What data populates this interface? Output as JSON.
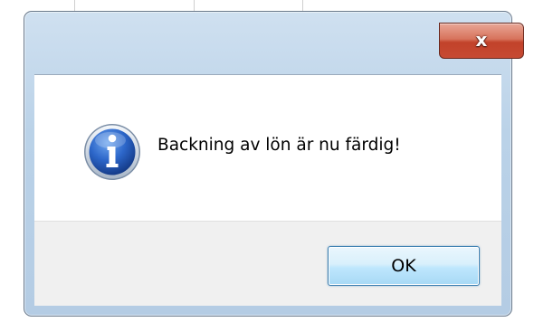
{
  "dialog": {
    "message": "Backning av lön är nu färdig!",
    "close_glyph": "x",
    "ok_label": "OK",
    "icon": "information-icon"
  },
  "colors": {
    "frame": "#bad2e8",
    "close_button": "#c64a33",
    "ok_button": "#bee6fd",
    "content_bg": "#ffffff",
    "footer_bg": "#f0f0f0",
    "icon_blue": "#1f57b8"
  }
}
